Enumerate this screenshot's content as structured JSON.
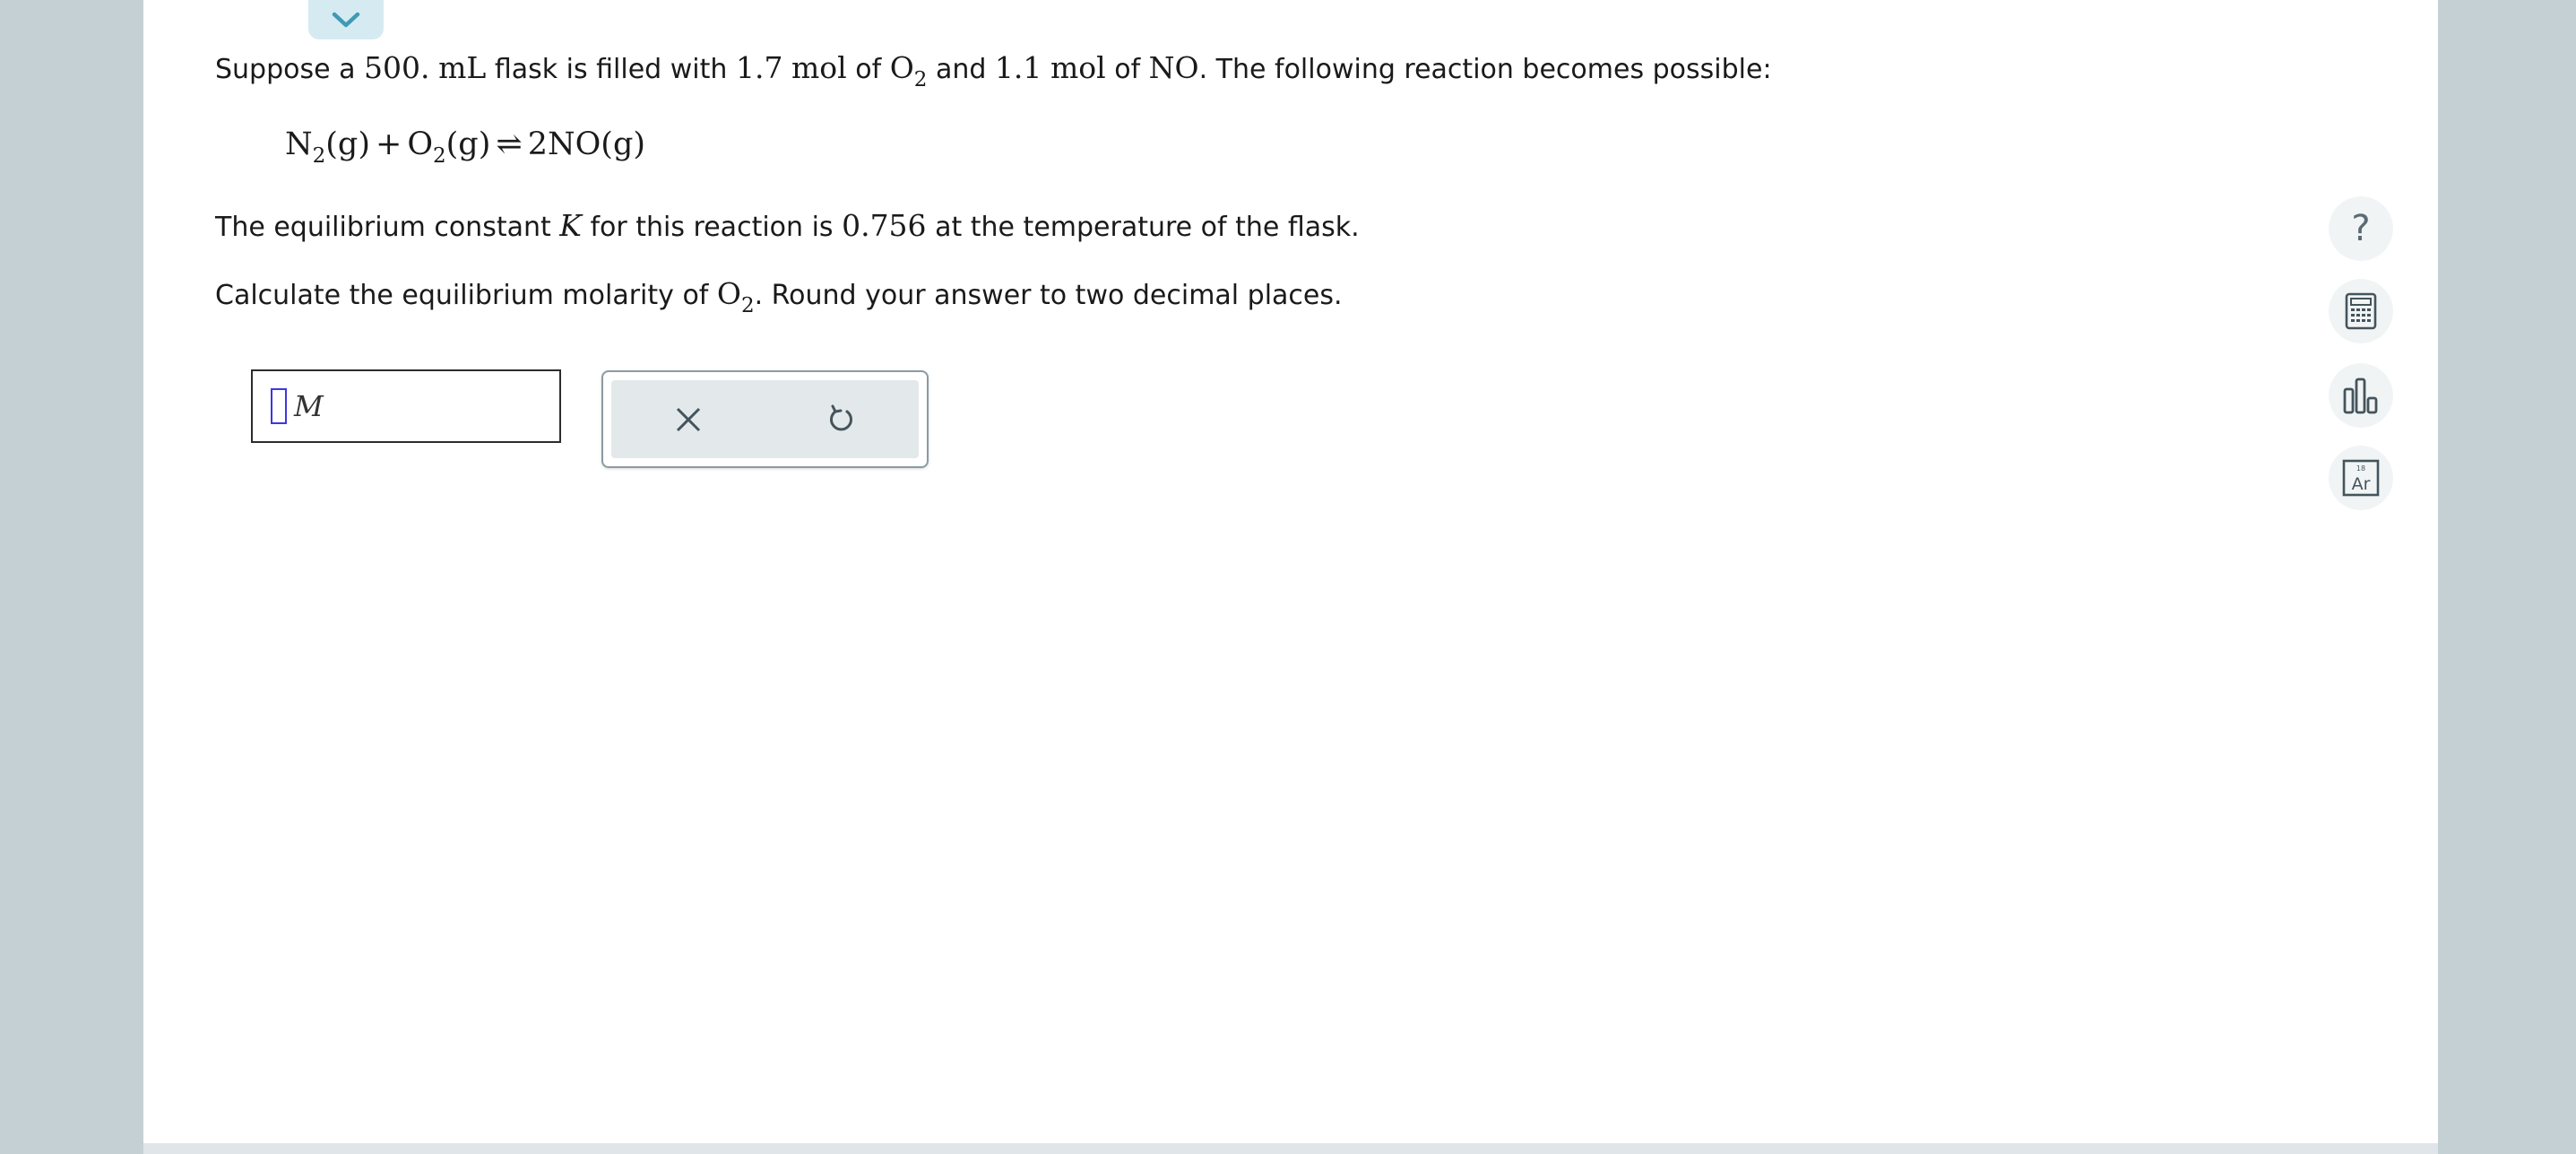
{
  "problem": {
    "line1": {
      "p1": "Suppose a ",
      "volume": "500.",
      "volume_unit": "mL",
      "p2": " flask is filled with ",
      "amt1": "1.7",
      "mol1": "mol",
      "p3": " of ",
      "sp1_main": "O",
      "sp1_sub": "2",
      "p4": " and ",
      "amt2": "1.1",
      "mol2": "mol",
      "p5": " of ",
      "sp2": "NO",
      "p6": ". The following reaction becomes possible:"
    },
    "equation": {
      "n": "N",
      "n_sub": "2",
      "g1": "(g)",
      "plus": "+",
      "o": "O",
      "o_sub": "2",
      "g2": "(g)",
      "arrow": "⇌",
      "product": "2NO",
      "g3": "(g)"
    },
    "line3": {
      "p1": "The equilibrium constant ",
      "k": "K",
      "p2": " for this reaction is ",
      "value": "0.756",
      "p3": " at the temperature of the flask."
    },
    "line4": {
      "p1": "Calculate the equilibrium molarity of ",
      "sp_main": "O",
      "sp_sub": "2",
      "p2": ". Round your answer to two decimal places."
    }
  },
  "answer": {
    "value": "",
    "unit": "M"
  },
  "actions": {
    "clear_icon": "x-icon",
    "undo_icon": "undo-icon"
  },
  "tools": {
    "help": "?",
    "help_icon": "question-icon",
    "calculator_icon": "calculator-icon",
    "chart_icon": "bar-chart-icon",
    "periodic_table_icon": "periodic-table-icon",
    "periodic_number": "18",
    "periodic_symbol": "Ar"
  },
  "colors": {
    "background": "#c5d0d5",
    "panel": "#ffffff",
    "accent": "#3f9bb5",
    "cursor": "#3d37e0",
    "icon": "#44545c"
  }
}
